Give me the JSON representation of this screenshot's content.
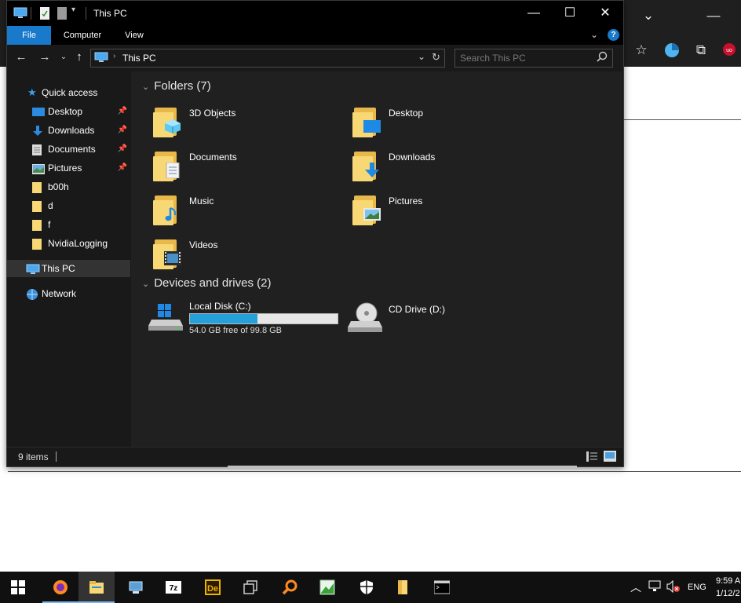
{
  "window": {
    "title": "This PC",
    "minimize": "—",
    "maximize": "☐",
    "close": "✕"
  },
  "ribbon": {
    "tabs": [
      {
        "label": "File"
      },
      {
        "label": "Computer"
      },
      {
        "label": "View"
      }
    ]
  },
  "address": {
    "path_label": "This PC",
    "search_placeholder": "Search This PC"
  },
  "nav": {
    "items": [
      {
        "label": "Quick access",
        "pinned": false
      },
      {
        "label": "Desktop",
        "pinned": true
      },
      {
        "label": "Downloads",
        "pinned": true
      },
      {
        "label": "Documents",
        "pinned": true
      },
      {
        "label": "Pictures",
        "pinned": true
      },
      {
        "label": "b00h",
        "pinned": false
      },
      {
        "label": "d",
        "pinned": false
      },
      {
        "label": "f",
        "pinned": false
      },
      {
        "label": "NvidiaLogging",
        "pinned": false
      },
      {
        "label": "This PC",
        "pinned": false
      },
      {
        "label": "Network",
        "pinned": false
      }
    ]
  },
  "content": {
    "folders_header": "Folders (7)",
    "folders": [
      {
        "label": "3D Objects"
      },
      {
        "label": "Desktop"
      },
      {
        "label": "Documents"
      },
      {
        "label": "Downloads"
      },
      {
        "label": "Music"
      },
      {
        "label": "Pictures"
      },
      {
        "label": "Videos"
      }
    ],
    "devices_header": "Devices and drives (2)",
    "drives": [
      {
        "label": "Local Disk (C:)",
        "free": "54.0 GB free of 99.8 GB",
        "used_fraction": 0.459
      },
      {
        "label": "CD Drive (D:)"
      }
    ]
  },
  "status": {
    "items_count": "9 items"
  },
  "taskbar": {
    "lang": "ENG",
    "time": "9:59 A",
    "date": "1/12/2"
  },
  "colors": {
    "accent": "#1979ca",
    "folder": "#f8d775",
    "drive_fill": "#26a0da"
  }
}
